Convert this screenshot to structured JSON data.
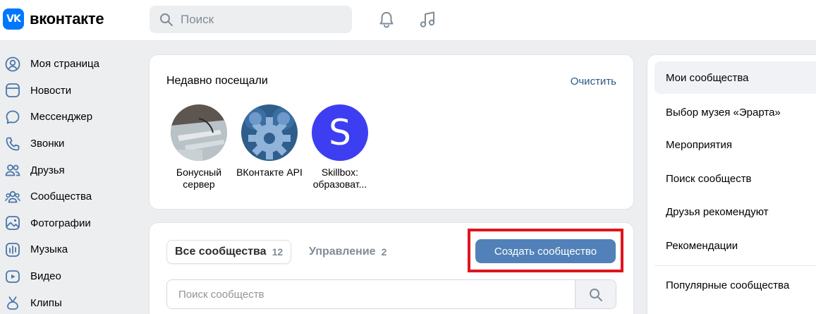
{
  "header": {
    "logo_mark": "VK",
    "logo_text": "вконтакте",
    "search_placeholder": "Поиск",
    "icons": [
      "bell-icon",
      "music-note-icon"
    ]
  },
  "nav": [
    {
      "label": "Моя страница",
      "icon": "user-circle-icon"
    },
    {
      "label": "Новости",
      "icon": "news-icon"
    },
    {
      "label": "Мессенджер",
      "icon": "chat-bubble-icon"
    },
    {
      "label": "Звонки",
      "icon": "phone-icon"
    },
    {
      "label": "Друзья",
      "icon": "friends-icon"
    },
    {
      "label": "Сообщества",
      "icon": "communities-icon"
    },
    {
      "label": "Фотографии",
      "icon": "photo-icon"
    },
    {
      "label": "Музыка",
      "icon": "music-icon"
    },
    {
      "label": "Видео",
      "icon": "video-icon"
    },
    {
      "label": "Клипы",
      "icon": "clips-icon"
    }
  ],
  "recent": {
    "title": "Недавно посещали",
    "clear_label": "Очистить",
    "groups": [
      {
        "name": "Бонусный сервер"
      },
      {
        "name": "ВКонтакте API"
      },
      {
        "name": "Skillbox: образоват...",
        "letter": "S"
      }
    ]
  },
  "communities": {
    "tab_all_label": "Все сообщества",
    "tab_all_count": "12",
    "tab_manage_label": "Управление",
    "tab_manage_count": "2",
    "create_label": "Создать сообщество",
    "search_placeholder": "Поиск сообществ"
  },
  "right_menu": {
    "items": [
      {
        "label": "Мои сообщества",
        "active": true
      },
      {
        "label": "Выбор музея «Эрарта»"
      },
      {
        "label": "Мероприятия"
      },
      {
        "label": "Поиск сообществ"
      },
      {
        "label": "Друзья рекомендуют"
      },
      {
        "label": "Рекомендации"
      },
      {
        "label": "Популярные сообщества"
      }
    ]
  },
  "colors": {
    "accent": "#0077ff",
    "button": "#5181b8",
    "link": "#2a5885",
    "highlight": "#e0141e",
    "skillbox": "#3d3ef2"
  }
}
